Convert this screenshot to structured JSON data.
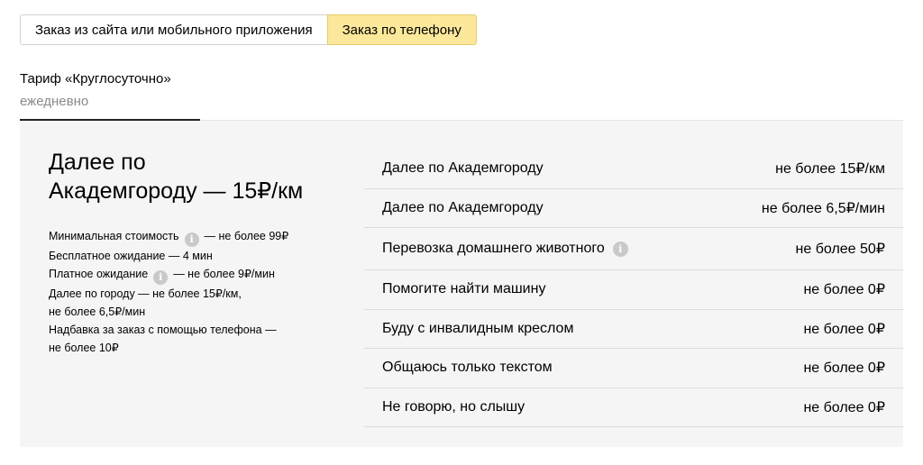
{
  "tabs": [
    {
      "label": "Заказ из сайта или мобильного приложения",
      "active": false
    },
    {
      "label": "Заказ по телефону",
      "active": true
    }
  ],
  "tariff": {
    "name": "Тариф «Круглосуточно»",
    "schedule": "ежедневно"
  },
  "summary": {
    "headline_line1": "Далее по",
    "headline_line2": "Академгороду — 15₽/км",
    "details": {
      "min_cost_label": "Минимальная стоимость",
      "min_cost_value": "— не более 99₽",
      "free_wait": "Бесплатное ожидание — 4 мин",
      "paid_wait_label": "Платное ожидание",
      "paid_wait_value": "— не более 9₽/мин",
      "city_line1": "Далее по городу — не более 15₽/км,",
      "city_line2": "не более 6,5₽/мин",
      "phone_fee_line1": "Надбавка за заказ с помощью телефона —",
      "phone_fee_line2": "не более 10₽"
    }
  },
  "rates": [
    {
      "label": "Далее по Академгороду",
      "value": "не более 15₽/км",
      "info": false
    },
    {
      "label": "Далее по Академгороду",
      "value": "не более 6,5₽/мин",
      "info": false
    },
    {
      "label": "Перевозка домашнего животного",
      "value": "не более 50₽",
      "info": true
    },
    {
      "label": "Помогите найти машину",
      "value": "не более 0₽",
      "info": false
    },
    {
      "label": "Буду с инвалидным креслом",
      "value": "не более 0₽",
      "info": false
    },
    {
      "label": "Общаюсь только текстом",
      "value": "не более 0₽",
      "info": false
    },
    {
      "label": "Не говорю, но слышу",
      "value": "не более 0₽",
      "info": false
    }
  ],
  "icons": {
    "info": "info-icon"
  },
  "colors": {
    "active_tab": "#fbe89a",
    "panel_bg": "#f5f5f5",
    "muted_text": "#8a8a8a"
  }
}
